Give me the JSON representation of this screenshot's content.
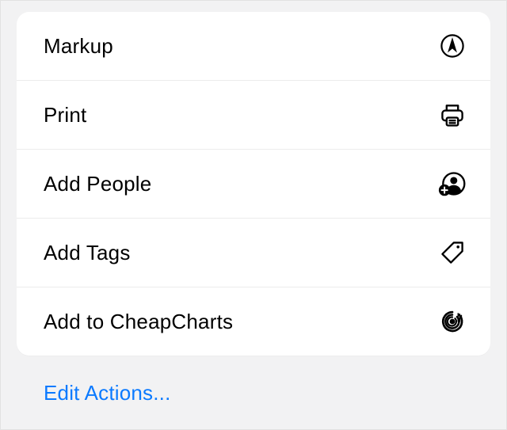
{
  "actions": [
    {
      "id": "markup",
      "label": "Markup",
      "icon": "markup-icon"
    },
    {
      "id": "print",
      "label": "Print",
      "icon": "printer-icon"
    },
    {
      "id": "add-people",
      "label": "Add People",
      "icon": "add-people-icon"
    },
    {
      "id": "add-tags",
      "label": "Add Tags",
      "icon": "tag-icon"
    },
    {
      "id": "add-to-cheapcharts",
      "label": "Add to CheapCharts",
      "icon": "cheapcharts-icon"
    }
  ],
  "footer": {
    "edit_actions_label": "Edit Actions..."
  }
}
